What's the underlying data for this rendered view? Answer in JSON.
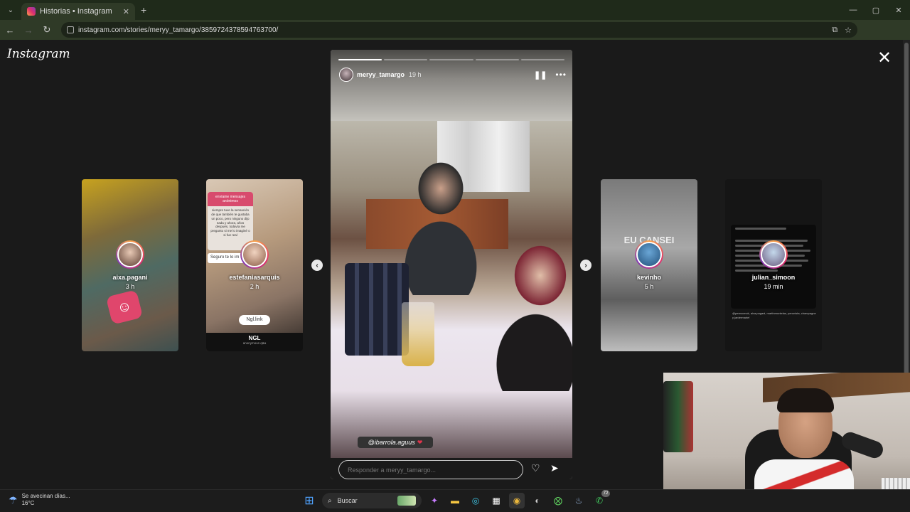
{
  "browser": {
    "tab_title": "Historias • Instagram",
    "tab_close": "✕",
    "new_tab": "+",
    "url": "instagram.com/stories/meryy_tamargo/3859724378594763700/",
    "window_controls": [
      "—",
      "▢",
      "✕"
    ]
  },
  "page": {
    "logo": "Instagram",
    "close": "✕"
  },
  "previews": [
    {
      "username": "aixa.pagani",
      "time": "3 h"
    },
    {
      "username": "estefaniasarquis",
      "time": "2 h",
      "ngl_link": "Ngl.link",
      "seguro_text": "Seguro te lo im",
      "ngl_title": "NGL",
      "anon_text": "anonymous q&a",
      "question_header": "envíame mensajes anónimos",
      "question_body": "siempre tuve la sensación de que también te gustaba un poco, pero ninguno dijo nada y ahora, años después, todavía me pregunto si me lo imaginé o si fue real"
    },
    {
      "username": "kevinho",
      "time": "5 h",
      "overlay_text": "EU CANSEI"
    },
    {
      "username": "julian_simoon",
      "time": "19 min",
      "tags_text": "@perezcmok, aixa.pagani, martinmuntelas, peronista, champagne y jardermarie!"
    }
  ],
  "story": {
    "username": "meryy_tamargo",
    "time": "19 h",
    "progress": [
      1.0,
      0.0,
      0.0,
      0.0,
      0.0
    ],
    "pause_icon": "❚❚",
    "more_icon": "•••",
    "mention": "@ibarrola.aguus",
    "mention_heart": "❤",
    "reply_placeholder": "Responder a meryy_tamargo...",
    "heart_icon": "♡",
    "send_icon": "➤"
  },
  "taskbar": {
    "weather_line1": "Se avecinan días...",
    "weather_line2": "16°C",
    "search_label": "Buscar",
    "steam_badge": "72"
  }
}
